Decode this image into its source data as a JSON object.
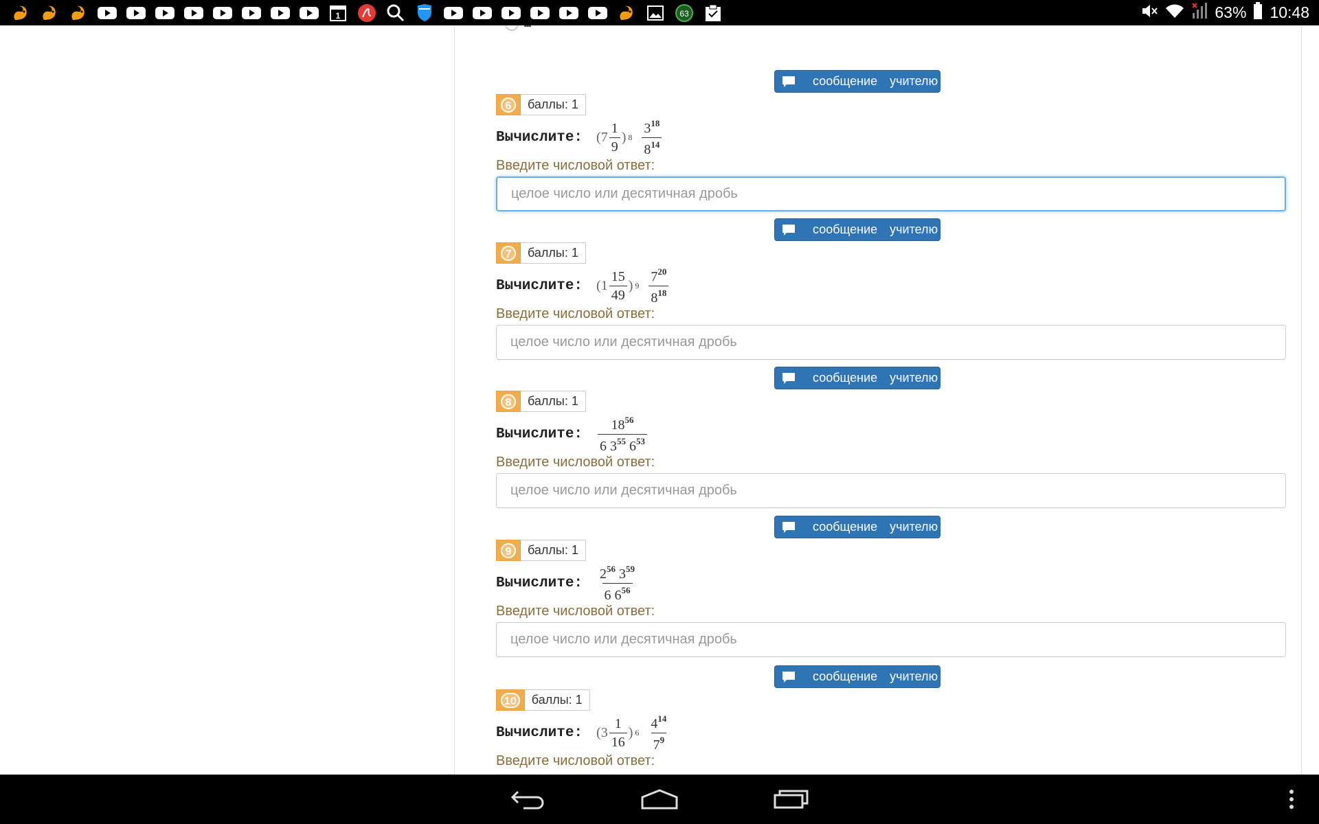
{
  "status_bar": {
    "notification_icons": [
      "squirrel-icon",
      "squirrel-icon",
      "squirrel-icon",
      "youtube-icon",
      "youtube-icon",
      "youtube-icon",
      "youtube-icon",
      "youtube-icon",
      "youtube-icon",
      "youtube-icon",
      "youtube-icon",
      "calendar-icon",
      "pdf-icon",
      "search-icon",
      "shield-icon",
      "youtube-icon",
      "youtube-icon",
      "youtube-icon",
      "youtube-icon",
      "youtube-icon",
      "youtube-icon",
      "squirrel-icon",
      "image-icon",
      "badge-icon",
      "clipboard-icon"
    ],
    "calendar_day": "1",
    "badge_count": "63",
    "battery": "63%",
    "time": "10:48"
  },
  "common": {
    "message_word1": "сообщение",
    "message_word2": "учителю",
    "question_label": "Вычислите:",
    "answer_prompt": "Введите числовой ответ:",
    "answer_placeholder": "целое число или десятичная дробь"
  },
  "tasks": [
    {
      "number": "6",
      "points": "баллы: 1"
    },
    {
      "number": "7",
      "points": "баллы: 1"
    },
    {
      "number": "8",
      "points": "баллы: 1"
    },
    {
      "number": "9",
      "points": "баллы: 1"
    },
    {
      "number": "10",
      "points": "баллы: 1"
    }
  ],
  "expressions": {
    "t6": {
      "open": "(7",
      "fn": "1",
      "fd": "9",
      "close": ")",
      "exp": "8",
      "num_b": "3",
      "num_e": "18",
      "den_b": "8",
      "den_e": "14"
    },
    "t7": {
      "open": "(1",
      "fn": "15",
      "fd": "49",
      "close": ")",
      "exp": "9",
      "num_b": "7",
      "num_e": "20",
      "den_b": "8",
      "den_e": "18"
    },
    "t8": {
      "num_b": "18",
      "num_e": "56",
      "den_a": "6 3",
      "den_ae": "55",
      "den_b": "6",
      "den_be": "53"
    },
    "t9": {
      "num_a": "2",
      "num_ae": "56",
      "num_b": "3",
      "num_be": "59",
      "den_a": "6 6",
      "den_ae": "56"
    },
    "t10": {
      "open": "(3",
      "fn": "1",
      "fd": "16",
      "close": ")",
      "exp": "6",
      "num_b": "4",
      "num_e": "14",
      "den_b": "7",
      "den_e": "9"
    }
  }
}
